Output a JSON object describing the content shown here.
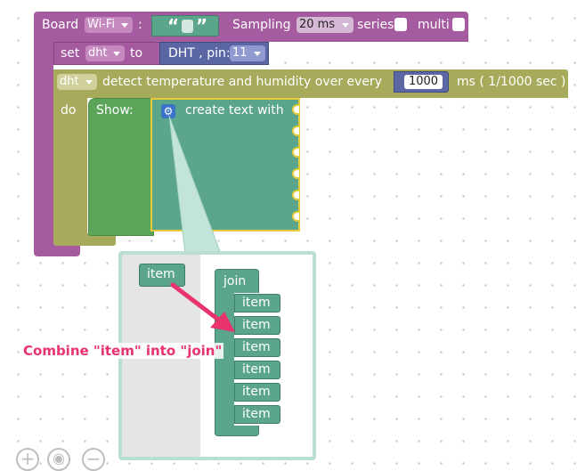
{
  "board_block": {
    "board_label": "Board",
    "board_value": "Wi-Fi",
    "colon": ":",
    "quote_open": "“",
    "quote_close": "”",
    "sampling_label": "Sampling",
    "sampling_value": "20 ms",
    "series_label": "series",
    "multi_label": "multi"
  },
  "set_block": {
    "set_label": "set",
    "var_name": "dht",
    "to_label": "to",
    "sensor_label": "DHT , pin:",
    "pin_value": "11"
  },
  "detect_block": {
    "var_name": "dht",
    "text": "detect temperature and humidity over every",
    "interval_value": "1000",
    "unit_label": "ms ( 1/1000 sec )",
    "do_label": "do"
  },
  "show_block": {
    "show_label": "Show:",
    "create_text_label": "create text with"
  },
  "mutator_popup": {
    "item_label": "item",
    "join_label": "join",
    "join_items": [
      "item",
      "item",
      "item",
      "item",
      "item",
      "item"
    ]
  },
  "annotation": {
    "text": "Combine \"item\" into \"join\"",
    "color": "#e8336d"
  },
  "zoom_controls": {
    "zoom_in_icon": "+",
    "reset_icon": "◉",
    "zoom_out_icon": "−"
  },
  "colors": {
    "purple": "#a55b9f",
    "olive": "#a7a95b",
    "blue_var": "#5b67a5",
    "green": "#5ba55b",
    "teal": "#5ba58c",
    "highlight": "#e8cc3a"
  }
}
